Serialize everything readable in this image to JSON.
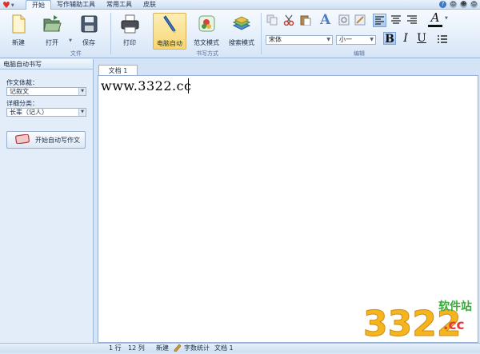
{
  "tabs": [
    "开始",
    "写作辅助工具",
    "常用工具",
    "皮肤"
  ],
  "ribbon": {
    "new_label": "新建",
    "open_label": "打开",
    "save_label": "保存",
    "print_label": "打印",
    "auto_label": "电脑自动",
    "sample_label": "范文模式",
    "search_label": "搜索模式",
    "group_file": "文件",
    "group_mode": "书写方式",
    "group_edit": "编辑",
    "font_name": "宋体",
    "font_size": "小一",
    "bold_glyph": "B",
    "italic_glyph": "I",
    "underline_glyph": "U"
  },
  "left": {
    "title": "电脑自动书写",
    "genre_label": "作文体裁：",
    "genre_value": "记叙文",
    "category_label": "详细分类：",
    "category_value": "长辈（记人）",
    "start_button": "开始自动写作文"
  },
  "doc": {
    "tab_label": "文档 1",
    "content": "www.3322.cc"
  },
  "status": {
    "line": "1 行",
    "col": "12 列",
    "new": "新建",
    "wordcount": "字数统计",
    "doc": "文档 1"
  },
  "watermark": {
    "brand_number": "3322",
    "site_cn": "软件站",
    "domain": ".cc"
  },
  "colors": {
    "ribbon_selected": "#f8d772",
    "panel_bg": "#e2edf9",
    "accent_blue": "#3d78c9"
  }
}
